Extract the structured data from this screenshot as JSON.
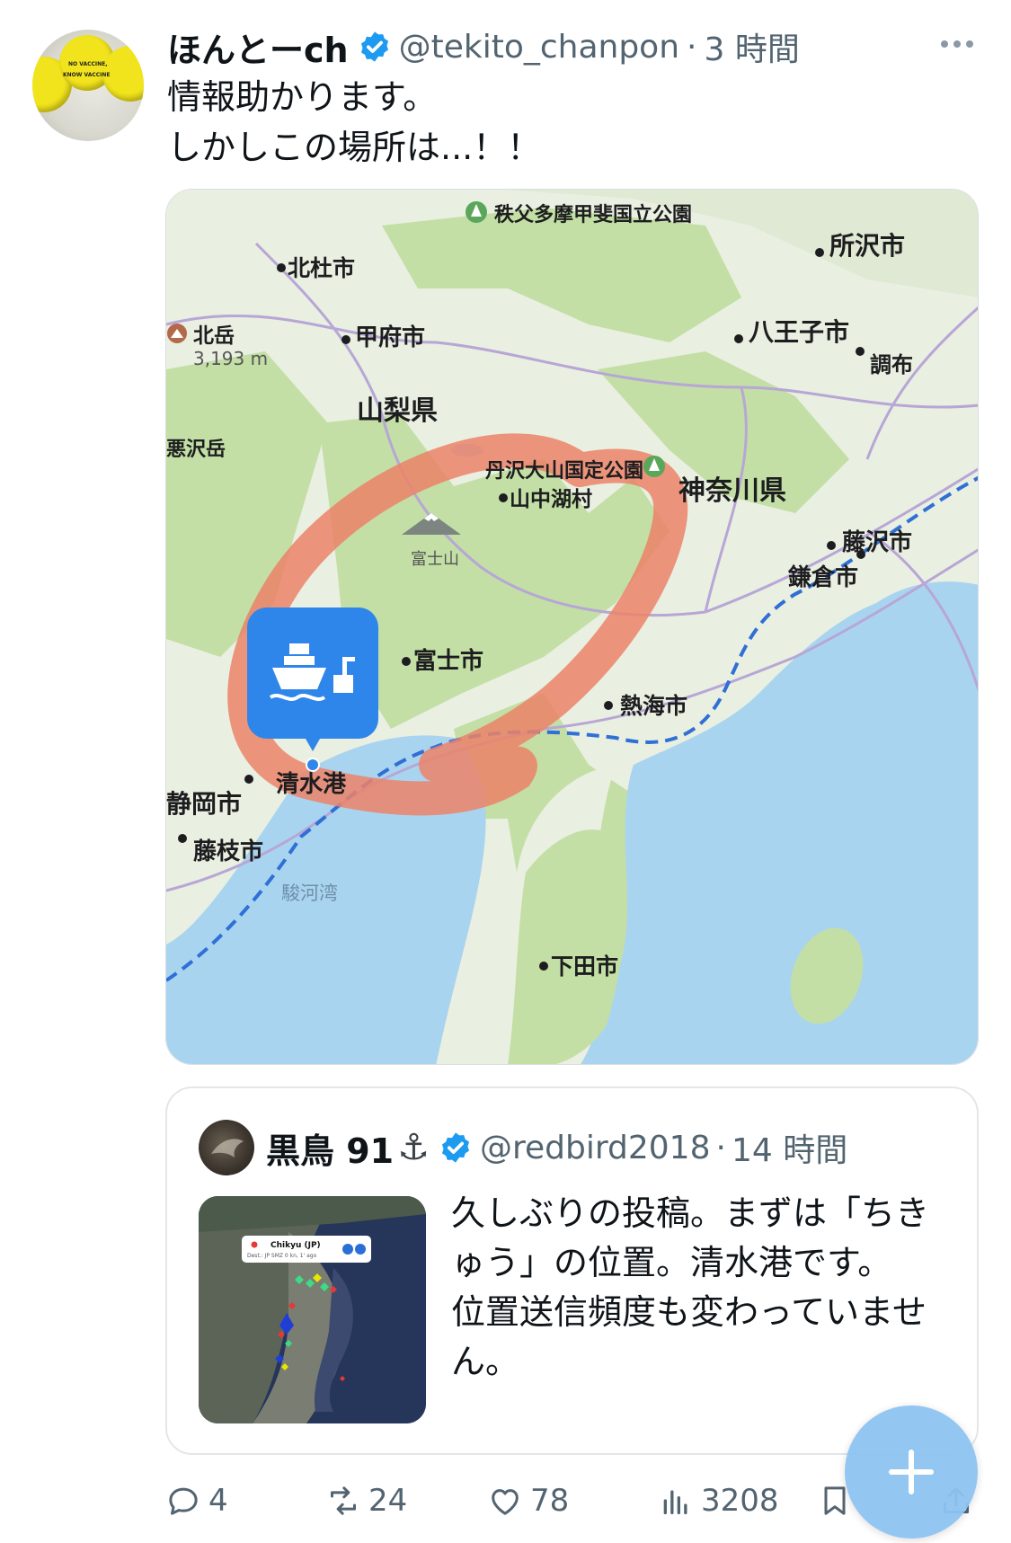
{
  "tweet": {
    "author": {
      "display_name": "ほんとーch",
      "handle": "@tekito_chanpon",
      "time": "3 時間",
      "avatar_text": [
        "NO VACCINE,",
        "KNOW VACCINE"
      ]
    },
    "text_lines": [
      "情報助かります。",
      "しかしこの場所は...！！"
    ]
  },
  "map": {
    "labels": {
      "park1": "秩父多摩甲斐国立公園",
      "hokuto": "北杜市",
      "tokorozawa": "所沢市",
      "kitadake": "北岳",
      "kitadake_elev": "3,193 m",
      "kofu": "甲府市",
      "hachioji": "八王子市",
      "chofu": "調布",
      "yamanashi": "山梨県",
      "warusawa": "悪沢岳",
      "park2": "丹沢大山国定公園",
      "yamanakako": "山中湖村",
      "kanagawa": "神奈川県",
      "fujisan": "富士山",
      "fujisawa": "藤沢市",
      "kamakura": "鎌倉市",
      "fuji": "富士市",
      "atami": "熱海市",
      "shimizu": "清水港",
      "shizuoka": "静岡市",
      "fujieda": "藤枝市",
      "suruga": "駿河湾",
      "shimoda": "下田市"
    },
    "colors": {
      "land": "#e9efe1",
      "forest": "#c3dfa5",
      "sea": "#a9d4f0",
      "circle": "#ec8268",
      "pin": "#2f86ea",
      "rail": "#2f6fd6"
    }
  },
  "quote": {
    "author": {
      "display_name": "黒鳥 91",
      "anchor": "⚓",
      "handle": "@redbird2018",
      "time": "14 時間"
    },
    "thumb": {
      "vessel": "Chikyu (JP)",
      "dest": "Dest.: JP SMZ  0 kn, 1' ago"
    },
    "text_lines": [
      "久しぶりの投稿。まずは「ちき",
      "ゅう」の位置。清水港です。",
      "位置送信頻度も変わっていませ",
      "ん。"
    ]
  },
  "actions": {
    "replies": "4",
    "reposts": "24",
    "likes": "78",
    "views": "3208"
  },
  "fab": {
    "label": "+"
  }
}
